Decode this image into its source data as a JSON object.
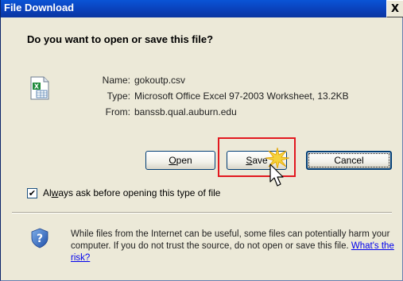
{
  "window": {
    "title": "File Download",
    "close_label": "X"
  },
  "prompt": {
    "question": "Do you want to open or save this file?"
  },
  "file_info": {
    "rows": [
      {
        "label": "Name:",
        "value": "gokoutp.csv"
      },
      {
        "label": "Type:",
        "value": "Microsoft Office Excel 97-2003 Worksheet, 13.2KB"
      },
      {
        "label": "From:",
        "value": "banssb.qual.auburn.edu"
      }
    ],
    "icon": "excel-file-icon"
  },
  "buttons": {
    "open": {
      "label_pre": "",
      "label_ul": "O",
      "label_post": "pen"
    },
    "save": {
      "label_pre": "",
      "label_ul": "S",
      "label_post": "ave"
    },
    "cancel": {
      "label": "Cancel"
    }
  },
  "checkbox": {
    "checked": true,
    "label_pre": "Al",
    "label_ul": "w",
    "label_post": "ays ask before opening this type of file"
  },
  "security": {
    "icon": "security-shield-icon",
    "text": "While files from the Internet can be useful, some files can potentially harm your computer. If you do not trust the source, do not open or save this file.",
    "link": "What's the risk?"
  },
  "colors": {
    "titlebar": "#0a3fb8",
    "dialog_bg": "#ece9d8",
    "highlight": "#e2181f",
    "link": "#0000ee"
  }
}
